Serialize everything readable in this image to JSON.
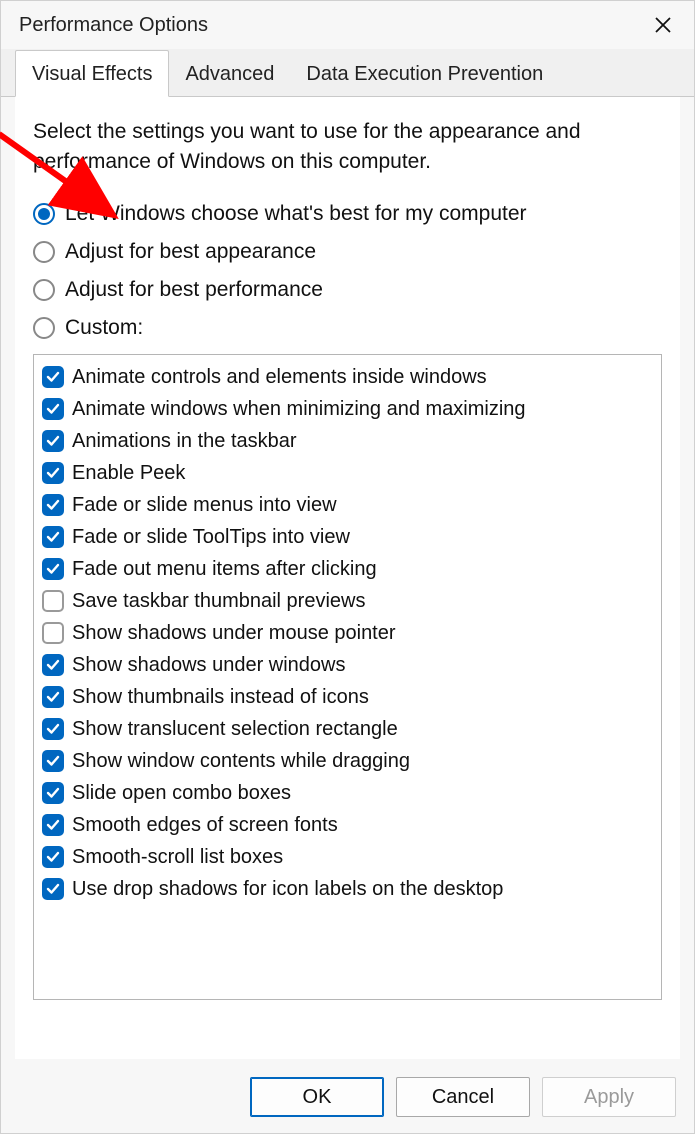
{
  "title": "Performance Options",
  "tabs": [
    {
      "label": "Visual Effects",
      "active": true
    },
    {
      "label": "Advanced",
      "active": false
    },
    {
      "label": "Data Execution Prevention",
      "active": false
    }
  ],
  "description": "Select the settings you want to use for the appearance and performance of Windows on this computer.",
  "radios": [
    {
      "label": "Let Windows choose what's best for my computer",
      "selected": true
    },
    {
      "label": "Adjust for best appearance",
      "selected": false
    },
    {
      "label": "Adjust for best performance",
      "selected": false
    },
    {
      "label": "Custom:",
      "selected": false
    }
  ],
  "checkboxes": [
    {
      "label": "Animate controls and elements inside windows",
      "checked": true
    },
    {
      "label": "Animate windows when minimizing and maximizing",
      "checked": true
    },
    {
      "label": "Animations in the taskbar",
      "checked": true
    },
    {
      "label": "Enable Peek",
      "checked": true
    },
    {
      "label": "Fade or slide menus into view",
      "checked": true
    },
    {
      "label": "Fade or slide ToolTips into view",
      "checked": true
    },
    {
      "label": "Fade out menu items after clicking",
      "checked": true
    },
    {
      "label": "Save taskbar thumbnail previews",
      "checked": false
    },
    {
      "label": "Show shadows under mouse pointer",
      "checked": false
    },
    {
      "label": "Show shadows under windows",
      "checked": true
    },
    {
      "label": "Show thumbnails instead of icons",
      "checked": true
    },
    {
      "label": "Show translucent selection rectangle",
      "checked": true
    },
    {
      "label": "Show window contents while dragging",
      "checked": true
    },
    {
      "label": "Slide open combo boxes",
      "checked": true
    },
    {
      "label": "Smooth edges of screen fonts",
      "checked": true
    },
    {
      "label": "Smooth-scroll list boxes",
      "checked": true
    },
    {
      "label": "Use drop shadows for icon labels on the desktop",
      "checked": true
    }
  ],
  "buttons": {
    "ok": "OK",
    "cancel": "Cancel",
    "apply": "Apply"
  }
}
